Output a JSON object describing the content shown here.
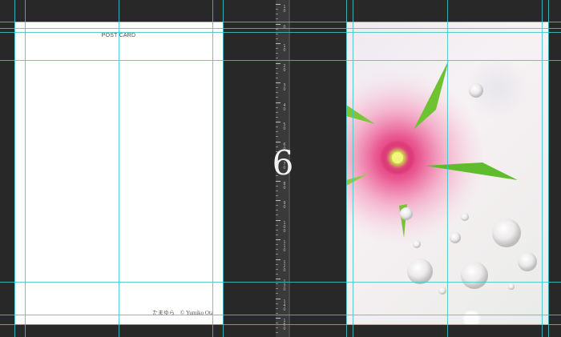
{
  "postcard": {
    "title": "POST CARD",
    "credit": "たまゆら　© Yumiko Ota"
  },
  "page_number": "6",
  "ruler": {
    "labels": [
      "10",
      "0",
      "10",
      "20",
      "30",
      "40",
      "50",
      "60",
      "70",
      "80",
      "90",
      "100",
      "110",
      "120",
      "130",
      "140",
      "150"
    ]
  },
  "colors": {
    "canvas": "#282828",
    "guide": "#39c6ce",
    "flower_pink": "#e23a78",
    "leaf_green": "#6fc232"
  },
  "image": {
    "subject": "pink-flower-with-water-drops"
  }
}
